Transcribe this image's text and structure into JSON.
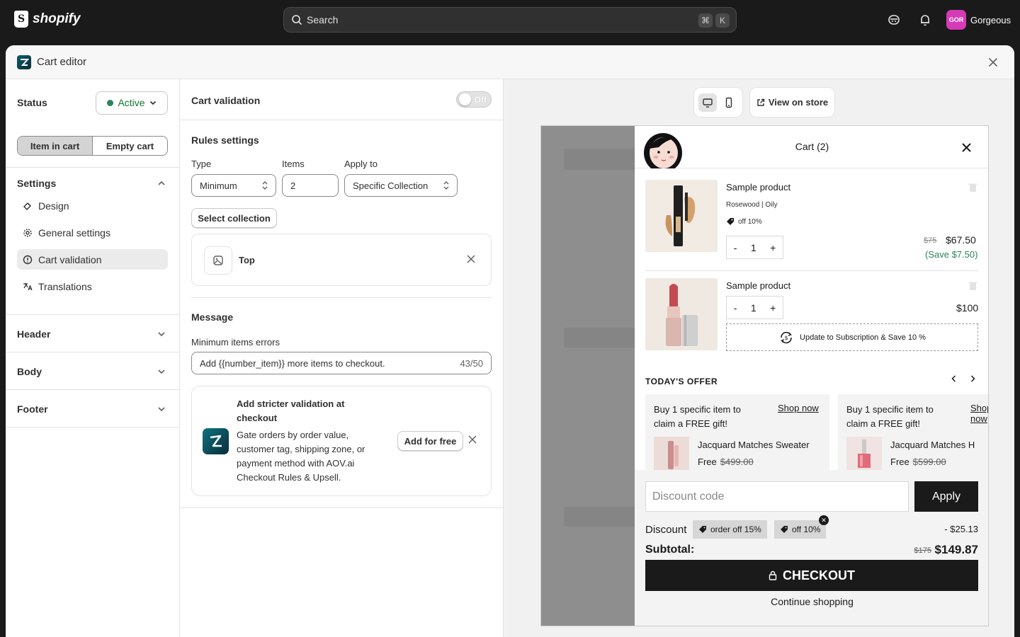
{
  "topbar": {
    "brand": "shopify",
    "search_placeholder": "Search",
    "kbd_cmd": "⌘",
    "kbd_k": "K",
    "store_initials": "GOR",
    "store_name": "Gorgeous"
  },
  "modal": {
    "title": "Cart editor"
  },
  "sidebar": {
    "status_label": "Status",
    "status_value": "Active",
    "tabs": [
      {
        "label": "Item in cart",
        "active": true
      },
      {
        "label": "Empty cart",
        "active": false
      }
    ],
    "settings_title": "Settings",
    "items": [
      {
        "label": "Design",
        "icon": "paint-brush-icon"
      },
      {
        "label": "General settings",
        "icon": "gear-icon"
      },
      {
        "label": "Cart validation",
        "icon": "alert-circle-icon",
        "active": true
      },
      {
        "label": "Translations",
        "icon": "translate-icon"
      }
    ],
    "sections": [
      {
        "label": "Header"
      },
      {
        "label": "Body"
      },
      {
        "label": "Footer"
      }
    ]
  },
  "validation": {
    "title": "Cart validation",
    "toggle_label": "Off",
    "rules_title": "Rules settings",
    "type_label": "Type",
    "type_value": "Minimum",
    "items_label": "Items",
    "items_value": "2",
    "apply_label": "Apply to",
    "apply_value": "Specific Collection",
    "select_collection": "Select collection",
    "collection_name": "Top",
    "message_title": "Message",
    "min_errors_label": "Minimum items errors",
    "min_errors_value": "Add {{number_item}} more items to checkout.",
    "min_errors_count": "43/50",
    "promo_title": "Add stricter validation at checkout",
    "promo_text": "Gate orders by order value, customer tag, shipping zone, or payment method with AOV.ai Checkout Rules & Upsell.",
    "promo_button": "Add for free"
  },
  "preview": {
    "view_on_store": "View on store",
    "cart_title": "Cart (2)",
    "products": [
      {
        "name": "Sample product",
        "variant": "Rosewood | Oily",
        "tag": "off 10%",
        "qty": "1",
        "old_price": "$75",
        "price": "$67.50",
        "save": "(Save $7.50)"
      },
      {
        "name": "Sample product",
        "qty": "1",
        "price": "$100",
        "subscription": "Update to Subscription & Save 10 %"
      }
    ],
    "qty_minus": "-",
    "qty_plus": "+",
    "offer_title": "TODAY'S OFFER",
    "offers": [
      {
        "text": "Buy 1 specific item to claim a FREE gift!",
        "link": "Shop now",
        "product": "Jacquard Matches Sweater",
        "free": "Free",
        "old": "$499.00"
      },
      {
        "text": "Buy 1 specific item to claim a FREE gift!",
        "link": "Shop now",
        "product": "Jacquard Matches H",
        "free": "Free",
        "old": "$599.00"
      }
    ],
    "discount_placeholder": "Discount code",
    "apply": "Apply",
    "discount_label": "Discount",
    "discount_chips": [
      "order off 15%",
      "off 10%"
    ],
    "discount_amount": "- $25.13",
    "subtotal_label": "Subtotal:",
    "subtotal_old": "$175",
    "subtotal_new": "$149.87",
    "checkout": "CHECKOUT",
    "continue": "Continue shopping"
  }
}
